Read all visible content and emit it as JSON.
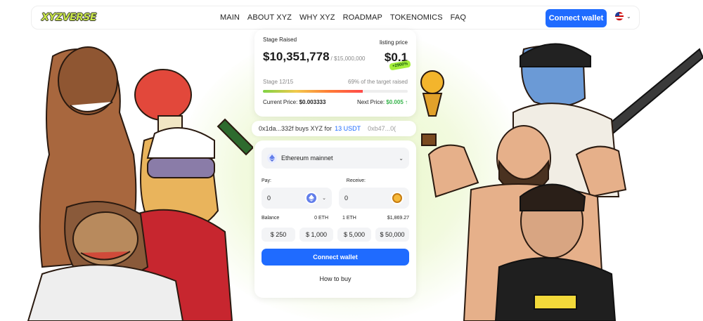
{
  "header": {
    "logo": "XYZVERSE",
    "nav": [
      "MAIN",
      "ABOUT XYZ",
      "WHY XYZ",
      "ROADMAP",
      "TOKENOMICS",
      "FAQ"
    ],
    "connect_label": "Connect wallet"
  },
  "presale": {
    "stage_raised_label": "Stage Raised",
    "listing_price_label": "listing price",
    "raised_amount": "$10,351,778",
    "raised_target": "/ $15,000,000",
    "listing_price": "$0.1",
    "growth_badge": "+2900%",
    "stage_label": "Stage 12/15",
    "target_note": "69% of the target raised",
    "progress_fraction": 0.69,
    "current_price_label": "Current Price:",
    "current_price": "$0.003333",
    "next_price_label": "Next Price:",
    "next_price": "$0.005 ↑"
  },
  "ticker": {
    "addr": "0x1da...332f buys XYZ for",
    "amount": "13 USDT",
    "next": "0xb47...0("
  },
  "swap": {
    "network": "Ethereum mainnet",
    "pay_label": "Pay:",
    "receive_label": "Receive:",
    "pay_value": "0",
    "receive_value": "0",
    "balance_label": "Balance",
    "balance_eth": "0 ETH",
    "rate_left": "1 ETH",
    "rate_right": "$1,869.27",
    "amounts": [
      "$ 250",
      "$ 1,000",
      "$ 5,000",
      "$ 50,000"
    ],
    "connect_label": "Connect wallet",
    "how_to_buy": "How to buy"
  },
  "colors": {
    "accent": "#1f6bff",
    "badge": "#a4ee3a",
    "green": "#35b34a"
  }
}
